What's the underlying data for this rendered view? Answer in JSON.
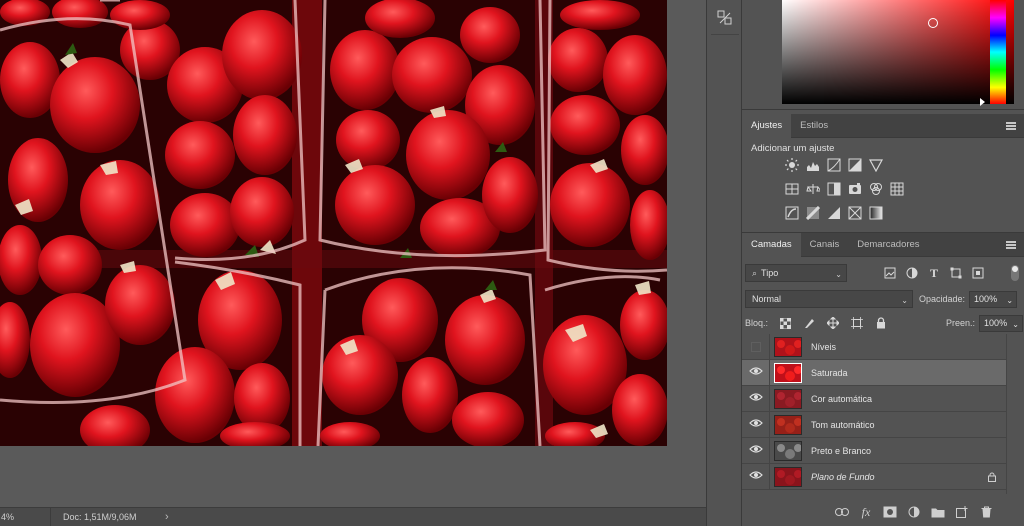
{
  "status": {
    "zoom": "4%",
    "doc": "Doc: 1,51M/9,06M"
  },
  "panels": {
    "adjust_tab": "Ajustes",
    "styles_tab": "Estilos",
    "adjust_title": "Adicionar um ajuste",
    "layers_tab": "Camadas",
    "channels_tab": "Canais",
    "paths_tab": "Demarcadores"
  },
  "layers": {
    "filter_kind": "Tipo",
    "blend_mode": "Normal",
    "opacity_label": "Opacidade:",
    "opacity_value": "100%",
    "lock_label": "Bloq.:",
    "fill_label": "Preen.:",
    "fill_value": "100%",
    "items": [
      {
        "name": "Níveis",
        "visible": false,
        "selected": false
      },
      {
        "name": "Saturada",
        "visible": true,
        "selected": true
      },
      {
        "name": "Cor automática",
        "visible": true,
        "selected": false
      },
      {
        "name": "Tom automático",
        "visible": true,
        "selected": false
      },
      {
        "name": "Preto e Branco",
        "visible": true,
        "selected": false
      },
      {
        "name": "Plano de Fundo",
        "visible": true,
        "selected": false
      }
    ]
  },
  "colors": {
    "panel": "#535353",
    "tab_bar": "#424242",
    "selected_layer": "#6a6a6a",
    "strawberry": "#c4121c"
  }
}
